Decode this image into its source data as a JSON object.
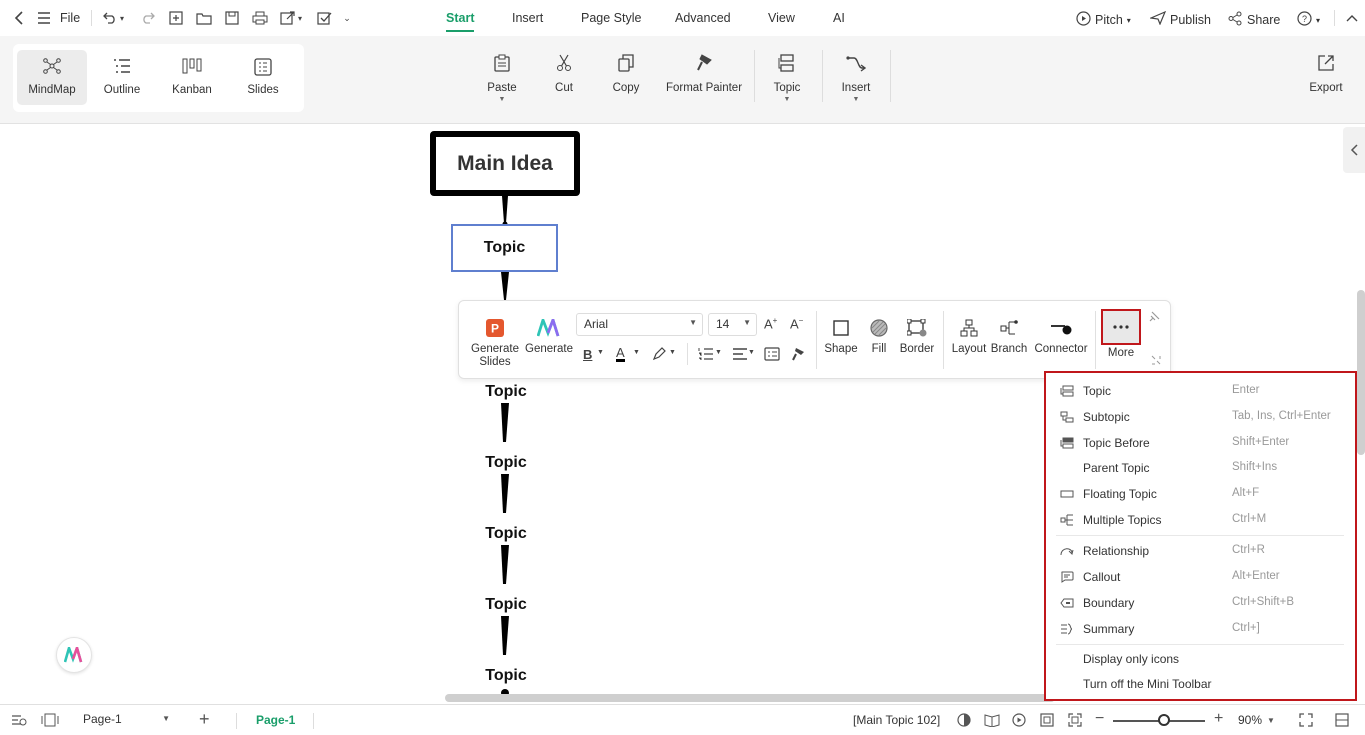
{
  "topbar": {
    "file_label": "File",
    "tabs": [
      {
        "label": "Start",
        "active": true
      },
      {
        "label": "Insert",
        "active": false
      },
      {
        "label": "Page Style",
        "active": false
      },
      {
        "label": "Advanced",
        "active": false
      },
      {
        "label": "View",
        "active": false
      },
      {
        "label": "AI",
        "active": false
      }
    ],
    "pitch_label": "Pitch",
    "publish_label": "Publish",
    "share_label": "Share"
  },
  "ribbon": {
    "views": [
      {
        "label": "MindMap",
        "icon": "mindmap-icon",
        "selected": true
      },
      {
        "label": "Outline",
        "icon": "outline-icon",
        "selected": false
      },
      {
        "label": "Kanban",
        "icon": "kanban-icon",
        "selected": false
      },
      {
        "label": "Slides",
        "icon": "slides-icon",
        "selected": false
      }
    ],
    "paste": "Paste",
    "cut": "Cut",
    "copy": "Copy",
    "format_painter": "Format Painter",
    "topic": "Topic",
    "insert": "Insert",
    "export": "Export"
  },
  "canvas": {
    "main_idea": "Main Idea",
    "selected_topic": "Topic",
    "topics": [
      "Topic",
      "Topic",
      "Topic",
      "Topic",
      "Topic"
    ]
  },
  "mini_toolbar": {
    "generate_slides": "Generate Slides",
    "generate": "Generate",
    "font": "Arial",
    "font_size": "14",
    "shape": "Shape",
    "fill": "Fill",
    "border": "Border",
    "layout": "Layout",
    "branch": "Branch",
    "connector": "Connector",
    "more": "More"
  },
  "more_menu": {
    "items": [
      {
        "label": "Topic",
        "shortcut": "Enter",
        "icon": "topic-icon"
      },
      {
        "label": "Subtopic",
        "shortcut": "Tab, Ins, Ctrl+Enter",
        "icon": "subtopic-icon"
      },
      {
        "label": "Topic Before",
        "shortcut": "Shift+Enter",
        "icon": "topic-before-icon"
      },
      {
        "label": "Parent Topic",
        "shortcut": "Shift+Ins",
        "icon": ""
      },
      {
        "label": "Floating Topic",
        "shortcut": "Alt+F",
        "icon": "floating-topic-icon"
      },
      {
        "label": "Multiple Topics",
        "shortcut": "Ctrl+M",
        "icon": "multiple-topics-icon"
      },
      {
        "label": "Relationship",
        "shortcut": "Ctrl+R",
        "icon": "relationship-icon"
      },
      {
        "label": "Callout",
        "shortcut": "Alt+Enter",
        "icon": "callout-icon"
      },
      {
        "label": "Boundary",
        "shortcut": "Ctrl+Shift+B",
        "icon": "boundary-icon"
      },
      {
        "label": "Summary",
        "shortcut": "Ctrl+]",
        "icon": "summary-icon"
      },
      {
        "label": "Display only icons",
        "shortcut": "",
        "icon": ""
      },
      {
        "label": "Turn off the Mini Toolbar",
        "shortcut": "",
        "icon": ""
      }
    ]
  },
  "statusbar": {
    "page_select": "Page-1",
    "page_tab": "Page-1",
    "selection_info": "[Main Topic 102]",
    "zoom": "90%",
    "zoom_level": 0.55
  },
  "colors": {
    "accent": "#1a9e6a",
    "highlight_border": "#c0171b",
    "selection_border": "#5f7fcf"
  }
}
